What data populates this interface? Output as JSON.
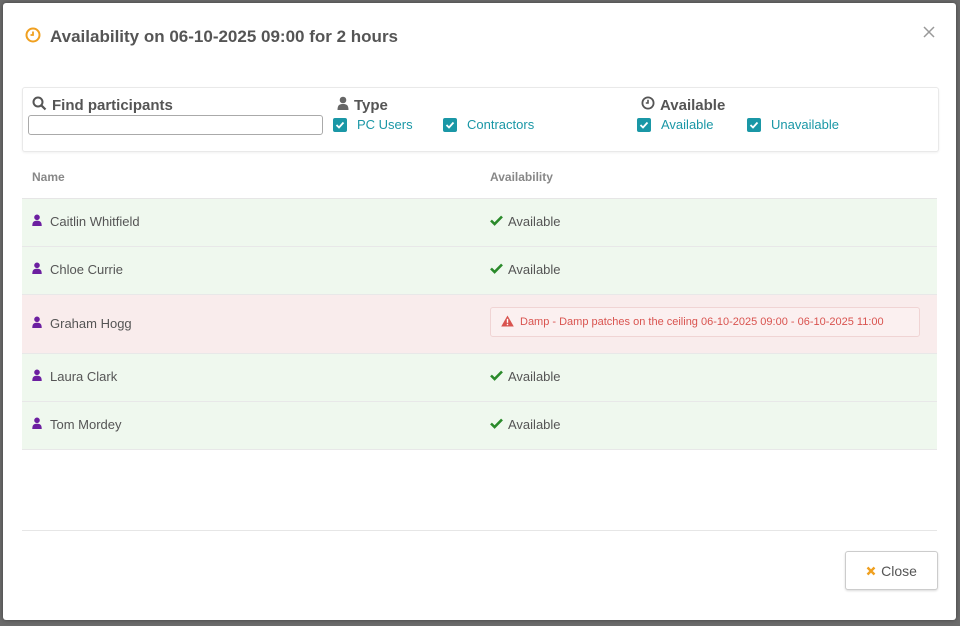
{
  "modal": {
    "title": "Availability on 06-10-2025 09:00 for 2 hours"
  },
  "filters": {
    "find": {
      "label": "Find participants",
      "value": ""
    },
    "type": {
      "label": "Type",
      "options": [
        {
          "label": "PC Users",
          "checked": true
        },
        {
          "label": "Contractors",
          "checked": true
        }
      ]
    },
    "available": {
      "label": "Available",
      "options": [
        {
          "label": "Available",
          "checked": true
        },
        {
          "label": "Unavailable",
          "checked": true
        }
      ]
    }
  },
  "table": {
    "columns": [
      "Name",
      "Availability"
    ],
    "rows": [
      {
        "name": "Caitlin Whitfield",
        "status": "Available"
      },
      {
        "name": "Chloe Currie",
        "status": "Available"
      },
      {
        "name": "Graham Hogg",
        "status": "Damp - Damp patches on the ceiling 06-10-2025 09:00 - 06-10-2025 11:00"
      },
      {
        "name": "Laura Clark",
        "status": "Available"
      },
      {
        "name": "Tom Mordey",
        "status": "Available"
      }
    ]
  },
  "footer": {
    "close_label": "Close"
  },
  "colors": {
    "accent": "#1a97a6",
    "title_icon": "#f0a020",
    "user_icon": "#6c1fa0",
    "available": "#2a8a2a",
    "unavailable": "#d9534f",
    "close_icon": "#f0a020"
  },
  "icons": {
    "title": "clock-icon",
    "find": "search-icon",
    "type": "user-icon",
    "available": "clock-icon",
    "row_user": "user-icon",
    "available_status": "check-icon",
    "unavailable_status": "warning-icon",
    "close": "close-icon"
  }
}
